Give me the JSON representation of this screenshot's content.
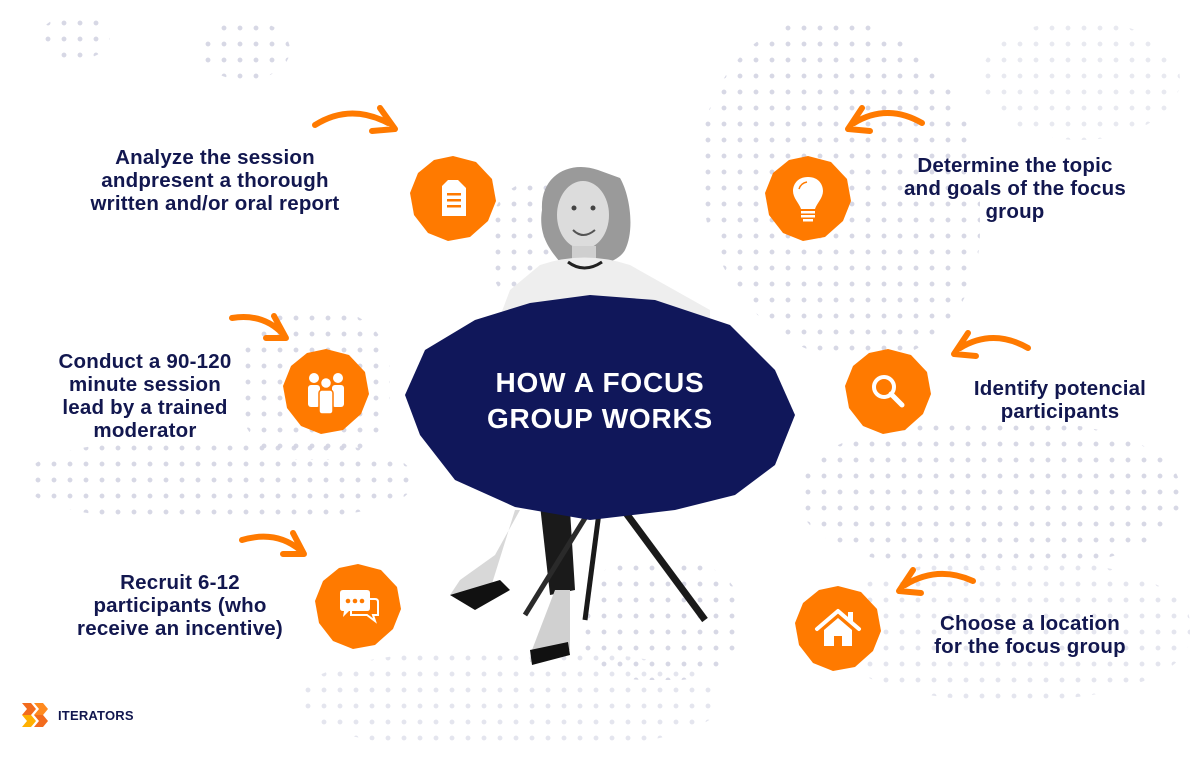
{
  "title": {
    "line1": "HOW A FOCUS",
    "line2": "GROUP WORKS"
  },
  "colors": {
    "accent": "#ff7a00",
    "navy": "#10175a",
    "text": "#12174f",
    "dots": "#d3d4e3"
  },
  "steps_right": [
    {
      "icon": "lightbulb-icon",
      "lines": [
        "Determine the topic",
        "and goals of the focus",
        "group"
      ]
    },
    {
      "icon": "search-icon",
      "lines": [
        "Identify potencial",
        "participants"
      ]
    },
    {
      "icon": "house-icon",
      "lines": [
        "Choose a location",
        "for the focus group"
      ]
    }
  ],
  "steps_left": [
    {
      "icon": "chat-icon",
      "lines": [
        "Recruit 6-12",
        "participants (who",
        "receive an incentive)"
      ]
    },
    {
      "icon": "people-icon",
      "lines": [
        "Conduct a 90-120",
        "minute session",
        "lead by a trained",
        "moderator"
      ]
    },
    {
      "icon": "document-icon",
      "lines": [
        "Analyze the session",
        "andpresent a thorough",
        "written and/or oral report"
      ]
    }
  ],
  "logo": {
    "text": "ITERATORS"
  }
}
